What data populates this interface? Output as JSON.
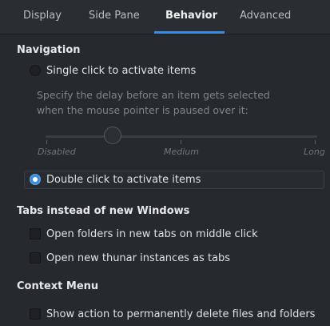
{
  "tabs": [
    {
      "label": "Display"
    },
    {
      "label": "Side Pane"
    },
    {
      "label": "Behavior"
    },
    {
      "label": "Advanced"
    }
  ],
  "active_tab": "Behavior",
  "navigation": {
    "title": "Navigation",
    "single_click_label": "Single click to activate items",
    "single_click_selected": false,
    "delay_description": "Specify the delay before an item gets selected when the mouse pointer is paused over it:",
    "slider_labels": {
      "min": "Disabled",
      "mid": "Medium",
      "max": "Long"
    },
    "double_click_label": "Double click to activate items",
    "double_click_selected": true
  },
  "tabs_section": {
    "title": "Tabs instead of new Windows",
    "middle_click_label": "Open folders in new tabs on middle click",
    "middle_click_checked": false,
    "new_instances_label": "Open new thunar instances as tabs",
    "new_instances_checked": false
  },
  "context_menu": {
    "title": "Context Menu",
    "permanent_delete_label": "Show action to permanently delete files and folders",
    "permanent_delete_checked": false
  },
  "colors": {
    "accent": "#3d8ee0",
    "background": "#26292d"
  }
}
